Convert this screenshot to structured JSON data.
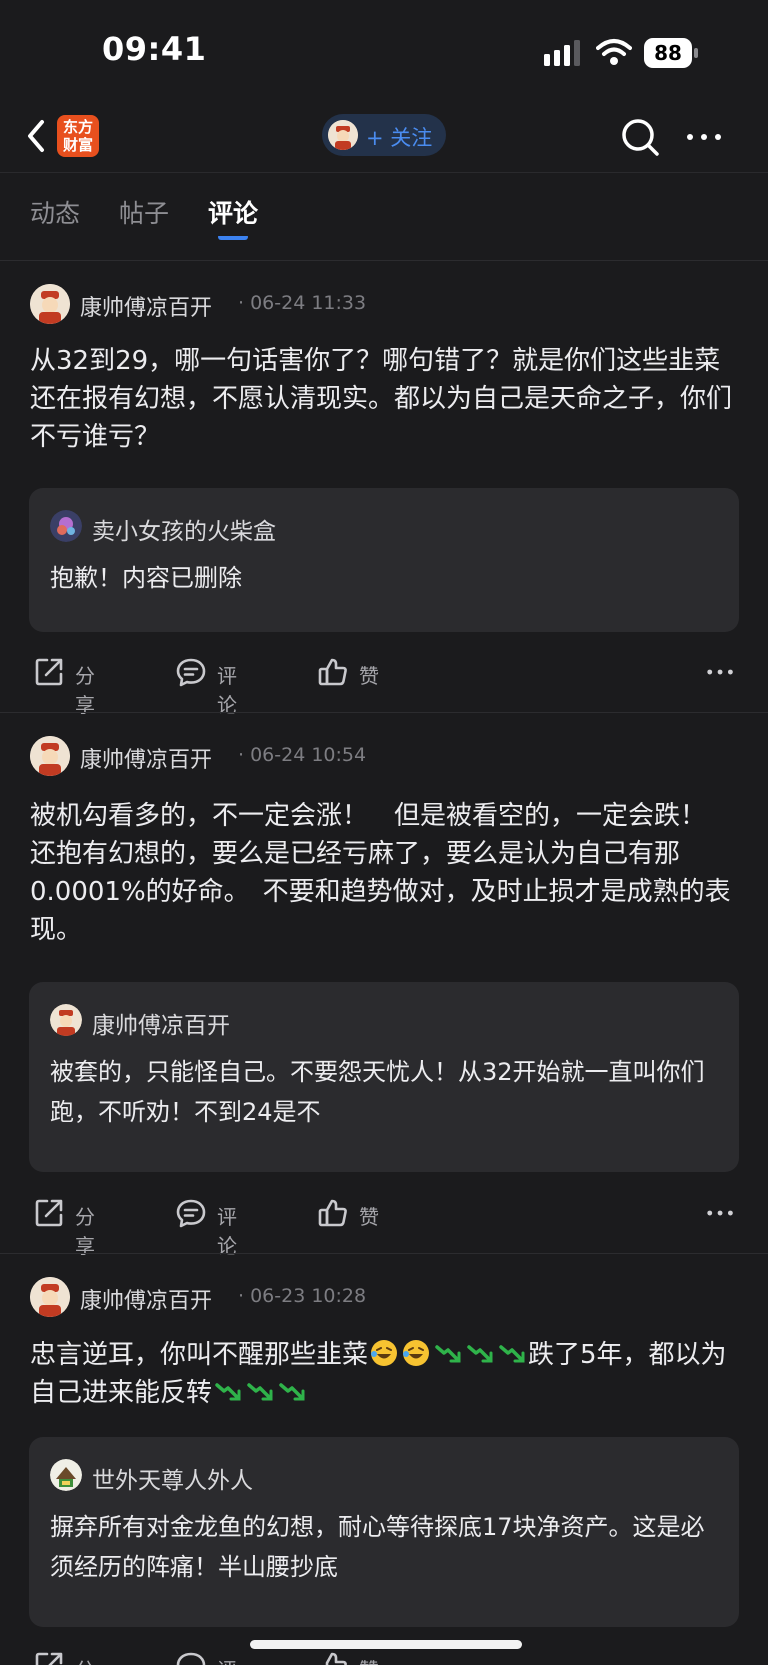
{
  "status_bar": {
    "time": "09:41",
    "battery": "88"
  },
  "nav": {
    "logo_text": "东方财富",
    "follow_label": "+ 关注"
  },
  "tabs": [
    {
      "label": "动态",
      "active": false
    },
    {
      "label": "帖子",
      "active": false
    },
    {
      "label": "评论",
      "active": true
    }
  ],
  "actions": {
    "share": "分享",
    "comment": "评论",
    "like": "赞"
  },
  "posts": [
    {
      "author": "康帅傅凉百开",
      "time": "06-24 11:33",
      "text": "从32到29，哪一句话害你了？哪句错了？就是你们这些韭菜还在报有幻想，不愿认清现实。都以为自己是天命之子，你们不亏谁亏？",
      "quote": {
        "author": "卖小女孩的火柴盒",
        "text": "抱歉！内容已删除"
      }
    },
    {
      "author": "康帅傅凉百开",
      "time": "06-24 10:54",
      "text": "被机勾看多的，不一定会涨！　但是被看空的，一定会跌！　还抱有幻想的，要么是已经亏麻了，要么是认为自己有那0.0001%的好命。　不要和趋势做对，及时止损才是成熟的表现。",
      "quote": {
        "author": "康帅傅凉百开",
        "text": "被套的，只能怪自己。不要怨天忧人！从32开始就一直叫你们跑，不听劝！不到24是不"
      }
    },
    {
      "author": "康帅傅凉百开",
      "time": "06-23 10:28",
      "text_parts": [
        "忠言逆耳，你叫不醒那些韭菜",
        "跌了5年，都以为自己进来能反转"
      ],
      "quote": {
        "author": "世外天尊人外人",
        "text": "摒弃所有对金龙鱼的幻想，耐心等待探底17块净资产。这是必须经历的阵痛！半山腰抄底"
      }
    }
  ],
  "colors": {
    "accent": "#3c82f0",
    "background": "#1b1b1d",
    "card": "#2b2b2e",
    "logo": "#e8501e"
  }
}
